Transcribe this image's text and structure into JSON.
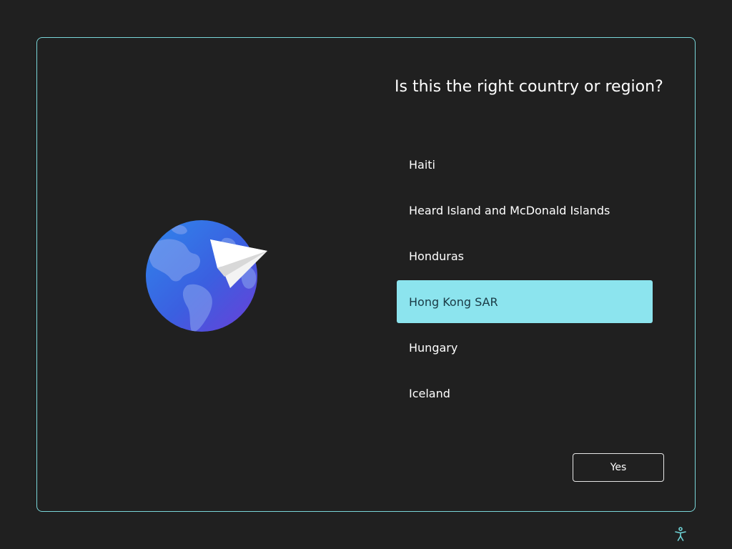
{
  "dialog": {
    "title": "Is this the right country or region?",
    "countries": [
      {
        "label": "Haiti",
        "selected": false
      },
      {
        "label": "Heard Island and McDonald Islands",
        "selected": false
      },
      {
        "label": "Honduras",
        "selected": false
      },
      {
        "label": "Hong Kong SAR",
        "selected": true
      },
      {
        "label": "Hungary",
        "selected": false
      },
      {
        "label": "Iceland",
        "selected": false
      }
    ],
    "yes_label": "Yes"
  },
  "icons": {
    "illustration": "globe-paper-plane-icon",
    "accessibility": "accessibility-icon"
  },
  "colors": {
    "background": "#202020",
    "dialog_border": "#7ad6d9",
    "selected_item": "#8ce4ee",
    "selected_text": "#1a3a45",
    "text": "#ffffff",
    "accent_icon": "#6fd3d6"
  }
}
